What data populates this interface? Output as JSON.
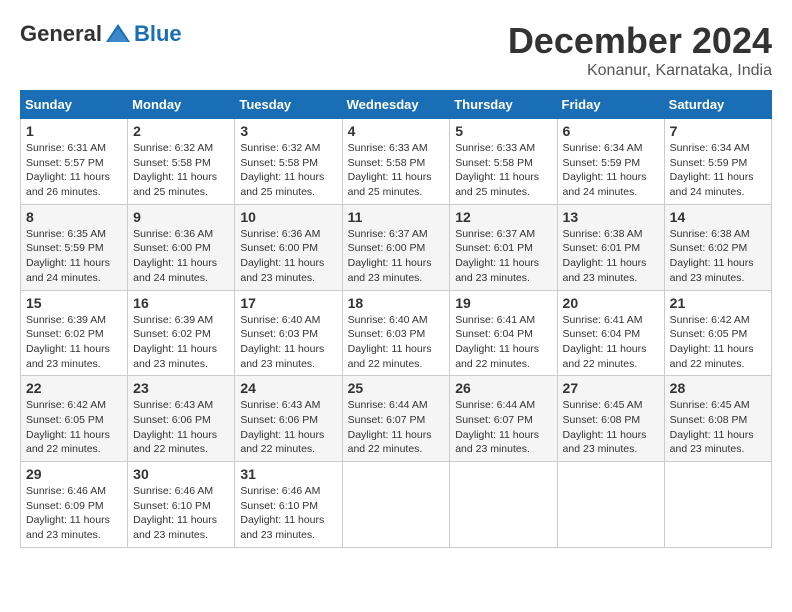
{
  "logo": {
    "general": "General",
    "blue": "Blue"
  },
  "title": "December 2024",
  "location": "Konanur, Karnataka, India",
  "days_of_week": [
    "Sunday",
    "Monday",
    "Tuesday",
    "Wednesday",
    "Thursday",
    "Friday",
    "Saturday"
  ],
  "weeks": [
    [
      {
        "day": "1",
        "info": "Sunrise: 6:31 AM\nSunset: 5:57 PM\nDaylight: 11 hours\nand 26 minutes."
      },
      {
        "day": "2",
        "info": "Sunrise: 6:32 AM\nSunset: 5:58 PM\nDaylight: 11 hours\nand 25 minutes."
      },
      {
        "day": "3",
        "info": "Sunrise: 6:32 AM\nSunset: 5:58 PM\nDaylight: 11 hours\nand 25 minutes."
      },
      {
        "day": "4",
        "info": "Sunrise: 6:33 AM\nSunset: 5:58 PM\nDaylight: 11 hours\nand 25 minutes."
      },
      {
        "day": "5",
        "info": "Sunrise: 6:33 AM\nSunset: 5:58 PM\nDaylight: 11 hours\nand 25 minutes."
      },
      {
        "day": "6",
        "info": "Sunrise: 6:34 AM\nSunset: 5:59 PM\nDaylight: 11 hours\nand 24 minutes."
      },
      {
        "day": "7",
        "info": "Sunrise: 6:34 AM\nSunset: 5:59 PM\nDaylight: 11 hours\nand 24 minutes."
      }
    ],
    [
      {
        "day": "8",
        "info": "Sunrise: 6:35 AM\nSunset: 5:59 PM\nDaylight: 11 hours\nand 24 minutes."
      },
      {
        "day": "9",
        "info": "Sunrise: 6:36 AM\nSunset: 6:00 PM\nDaylight: 11 hours\nand 24 minutes."
      },
      {
        "day": "10",
        "info": "Sunrise: 6:36 AM\nSunset: 6:00 PM\nDaylight: 11 hours\nand 23 minutes."
      },
      {
        "day": "11",
        "info": "Sunrise: 6:37 AM\nSunset: 6:00 PM\nDaylight: 11 hours\nand 23 minutes."
      },
      {
        "day": "12",
        "info": "Sunrise: 6:37 AM\nSunset: 6:01 PM\nDaylight: 11 hours\nand 23 minutes."
      },
      {
        "day": "13",
        "info": "Sunrise: 6:38 AM\nSunset: 6:01 PM\nDaylight: 11 hours\nand 23 minutes."
      },
      {
        "day": "14",
        "info": "Sunrise: 6:38 AM\nSunset: 6:02 PM\nDaylight: 11 hours\nand 23 minutes."
      }
    ],
    [
      {
        "day": "15",
        "info": "Sunrise: 6:39 AM\nSunset: 6:02 PM\nDaylight: 11 hours\nand 23 minutes."
      },
      {
        "day": "16",
        "info": "Sunrise: 6:39 AM\nSunset: 6:02 PM\nDaylight: 11 hours\nand 23 minutes."
      },
      {
        "day": "17",
        "info": "Sunrise: 6:40 AM\nSunset: 6:03 PM\nDaylight: 11 hours\nand 23 minutes."
      },
      {
        "day": "18",
        "info": "Sunrise: 6:40 AM\nSunset: 6:03 PM\nDaylight: 11 hours\nand 22 minutes."
      },
      {
        "day": "19",
        "info": "Sunrise: 6:41 AM\nSunset: 6:04 PM\nDaylight: 11 hours\nand 22 minutes."
      },
      {
        "day": "20",
        "info": "Sunrise: 6:41 AM\nSunset: 6:04 PM\nDaylight: 11 hours\nand 22 minutes."
      },
      {
        "day": "21",
        "info": "Sunrise: 6:42 AM\nSunset: 6:05 PM\nDaylight: 11 hours\nand 22 minutes."
      }
    ],
    [
      {
        "day": "22",
        "info": "Sunrise: 6:42 AM\nSunset: 6:05 PM\nDaylight: 11 hours\nand 22 minutes."
      },
      {
        "day": "23",
        "info": "Sunrise: 6:43 AM\nSunset: 6:06 PM\nDaylight: 11 hours\nand 22 minutes."
      },
      {
        "day": "24",
        "info": "Sunrise: 6:43 AM\nSunset: 6:06 PM\nDaylight: 11 hours\nand 22 minutes."
      },
      {
        "day": "25",
        "info": "Sunrise: 6:44 AM\nSunset: 6:07 PM\nDaylight: 11 hours\nand 22 minutes."
      },
      {
        "day": "26",
        "info": "Sunrise: 6:44 AM\nSunset: 6:07 PM\nDaylight: 11 hours\nand 23 minutes."
      },
      {
        "day": "27",
        "info": "Sunrise: 6:45 AM\nSunset: 6:08 PM\nDaylight: 11 hours\nand 23 minutes."
      },
      {
        "day": "28",
        "info": "Sunrise: 6:45 AM\nSunset: 6:08 PM\nDaylight: 11 hours\nand 23 minutes."
      }
    ],
    [
      {
        "day": "29",
        "info": "Sunrise: 6:46 AM\nSunset: 6:09 PM\nDaylight: 11 hours\nand 23 minutes."
      },
      {
        "day": "30",
        "info": "Sunrise: 6:46 AM\nSunset: 6:10 PM\nDaylight: 11 hours\nand 23 minutes."
      },
      {
        "day": "31",
        "info": "Sunrise: 6:46 AM\nSunset: 6:10 PM\nDaylight: 11 hours\nand 23 minutes."
      },
      {
        "day": "",
        "info": ""
      },
      {
        "day": "",
        "info": ""
      },
      {
        "day": "",
        "info": ""
      },
      {
        "day": "",
        "info": ""
      }
    ]
  ]
}
